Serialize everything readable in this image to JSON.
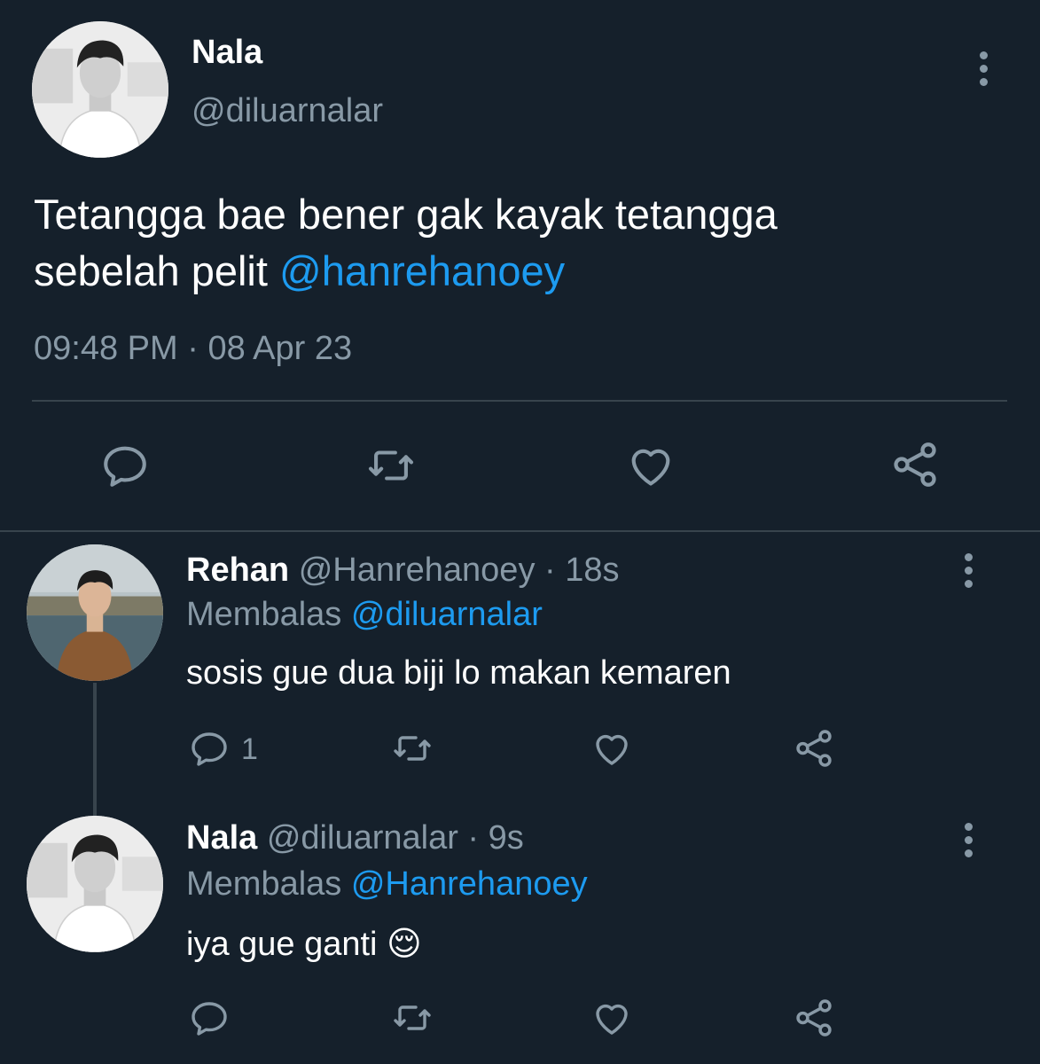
{
  "main_tweet": {
    "name": "Nala",
    "handle": "@diluarnalar",
    "text_line1": "Tetangga bae bener gak kayak tetangga",
    "text_line2_prefix": "sebelah pelit ",
    "mention": "@hanrehanoey",
    "time": "09:48 PM",
    "date": "08 Apr 23",
    "separator": " · "
  },
  "replies": [
    {
      "name": "Rehan",
      "handle": "@Hanrehanoey",
      "age": "18s",
      "replying_label": "Membalas",
      "replying_to": "@diluarnalar",
      "text": "sosis gue dua biji lo makan kemaren",
      "reply_count": "1"
    },
    {
      "name": "Nala",
      "handle": "@diluarnalar",
      "age": "9s",
      "replying_label": "Membalas",
      "replying_to": "@Hanrehanoey",
      "text": "iya gue ganti",
      "emoji": "😌"
    }
  ],
  "icons": {
    "reply": "reply-icon",
    "retweet": "retweet-icon",
    "like": "heart-icon",
    "share": "share-icon",
    "more": "more-vertical-icon"
  },
  "colors": {
    "background": "#15202b",
    "accent": "#1d9bf0",
    "muted": "#8899a6",
    "divider": "#38444d"
  }
}
